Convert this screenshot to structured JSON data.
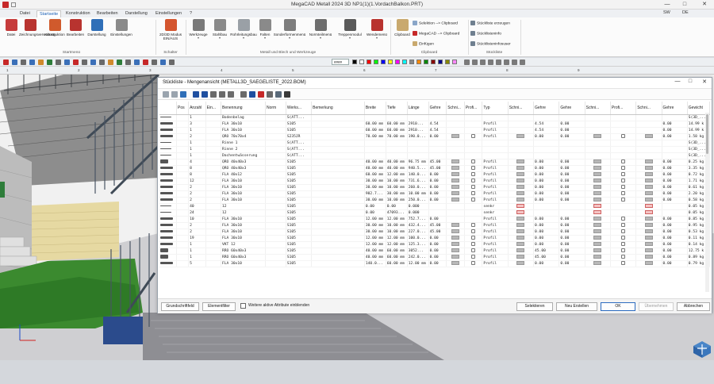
{
  "app": {
    "title": "MegaCAD Metall 2024 3D NP1(1)(1.VordachBalkon.PRT)",
    "user": "SW",
    "help": "?",
    "lang": "DE"
  },
  "ribbon_tabs": [
    "Datei",
    "Startseite",
    "Konstruktion",
    "Bearbeiten",
    "Darstellung",
    "Einstellungen",
    "?"
  ],
  "ribbon": {
    "start_buttons": [
      {
        "label": "Datei",
        "color": "#c63b3b"
      },
      {
        "label": "Zeichnungsverwaltung",
        "color": "#b8332f"
      },
      {
        "label": "Konstruktion",
        "color": "#d05a2c"
      },
      {
        "label": "Bearbeiten",
        "color": "#b8332f"
      },
      {
        "label": "Darstellung",
        "color": "#2f6fb8"
      },
      {
        "label": "Einstellungen",
        "color": "#8a8a8a"
      }
    ],
    "start_group": "Startmenü",
    "switch_button": {
      "label_1": "2D/3D Modus",
      "label_2": "EIN/AUS"
    },
    "switch_group": "Schalter",
    "metal_buttons": [
      {
        "label": "Werkzeuge",
        "color": "#7a7a7a"
      },
      {
        "label": "Stahlbau",
        "color": "#8a8a8a"
      },
      {
        "label": "Rohrleitungsbau",
        "color": "#9aa0a6"
      },
      {
        "label": "Falten",
        "color": "#8a8a8a"
      },
      {
        "label": "Sonderformenmenü",
        "color": "#7d7d7d"
      },
      {
        "label": "Normteilmenü",
        "color": "#6e6e6e"
      },
      {
        "label": "Treppenmodul",
        "color": "#5a5a5a"
      },
      {
        "label": "Wendemenü",
        "color": "#b8332f"
      }
    ],
    "metal_group": "Metall und Blech und Werkzeuge",
    "clipboard_button": "Clipboard",
    "clipboard_items": [
      "Selektion --> Clipboard",
      "MegaCAD --> Clipboard",
      "Einfügen"
    ],
    "clipboard_group": "Clipboard",
    "parts_items": [
      "Stückliste erzeugen",
      "Stücklisteninfo",
      "Stücklisteninfosuser"
    ],
    "parts_group": "Stückliste"
  },
  "toolbar": {
    "pattern": "####",
    "ruler_numbers": [
      "1",
      "2",
      "3",
      "4",
      "5",
      "6",
      "7",
      "8",
      "9"
    ],
    "colors": [
      "#000000",
      "#ffffff",
      "#ff0000",
      "#00ff00",
      "#0000ff",
      "#ffff00",
      "#ff00ff",
      "#00ffff",
      "#888888",
      "#ff8800",
      "#008800",
      "#880000",
      "#000088",
      "#888800",
      "#ff88ff"
    ]
  },
  "dialog": {
    "title": "Stückliste - Mengenansicht (METALL3D_SAEGELISTE_2022.BOM)",
    "columns": [
      "",
      "Pos",
      "Anzahl",
      "Ein...",
      "Benennung",
      "Norm",
      "Werks...",
      "Bemerkung",
      "Breite",
      "Tiefe",
      "Länge",
      "Gehre",
      "Schni...",
      "Profi...",
      "Typ",
      "Schni...",
      "Gehre",
      "Gehre",
      "Schni...",
      "Profi...",
      "Schni...",
      "Gehre",
      "Gewicht"
    ],
    "rows": [
      {
        "thumb": "line",
        "pos": "",
        "anz": "1",
        "ein": "",
        "ben": "Bodenbelag",
        "benBlue": true,
        "norm": "",
        "werk": "S(ATT...",
        "werkBlue": false,
        "bem": "",
        "breite": "",
        "tiefe": "",
        "laenge": "",
        "gehre": "",
        "s1": "",
        "p1": "",
        "typ": "",
        "s2": "",
        "g2": "",
        "g3": "",
        "s3": "",
        "p2": "",
        "s4": "",
        "g4": "",
        "gew": "S(3D_..."
      },
      {
        "thumb": "bar",
        "pos": "",
        "anz": "3",
        "ein": "",
        "ben": "FLA 30x10",
        "benBlue": false,
        "norm": "",
        "werk": "S105",
        "werkBlue": true,
        "bem": "",
        "breite": "60.00 mm",
        "tiefe": "60.00 mm",
        "laenge": "2910...",
        "gehre": "4.54",
        "s1": "",
        "p1": "",
        "typ": "Profil",
        "s2": "",
        "g2": "4.54",
        "g3": "0.00",
        "s3": "",
        "p2": "",
        "s4": "",
        "g4": "0.00",
        "gew": "14.99 k"
      },
      {
        "thumb": "bar",
        "pos": "",
        "anz": "1",
        "ein": "",
        "ben": "FLA 30x10",
        "benBlue": false,
        "norm": "",
        "werk": "S105",
        "werkBlue": true,
        "bem": "",
        "breite": "60.00 mm",
        "tiefe": "60.00 mm",
        "laenge": "2910...",
        "gehre": "4.54",
        "s1": "",
        "p1": "",
        "typ": "Profil",
        "s2": "",
        "g2": "4.54",
        "g3": "0.00",
        "s3": "",
        "p2": "",
        "s4": "",
        "g4": "0.00",
        "gew": "14.99 k"
      },
      {
        "thumb": "bar",
        "pos": "",
        "anz": "2",
        "ein": "",
        "ben": "QRO 70x70x4",
        "benBlue": false,
        "norm": "",
        "werk": "S235JR",
        "werkBlue": true,
        "bem": "",
        "breite": "70.00 mm",
        "tiefe": "70.00 mm",
        "laenge": "190.0...",
        "gehre": "0.00",
        "s1": "m",
        "p1": "p",
        "typ": "Profil",
        "s2": "m",
        "g2": "0.00",
        "g3": "0.00",
        "s3": "m",
        "p2": "p",
        "s4": "m",
        "g4": "0.00",
        "gew": "1.58 kg"
      },
      {
        "thumb": "line",
        "pos": "",
        "anz": "1",
        "ein": "",
        "ben": "Rinne 1",
        "benBlue": true,
        "norm": "",
        "werk": "S(ATT...",
        "werkBlue": false,
        "bem": "",
        "breite": "",
        "tiefe": "",
        "laenge": "",
        "gehre": "",
        "s1": "",
        "p1": "",
        "typ": "",
        "s2": "",
        "g2": "",
        "g3": "",
        "s3": "",
        "p2": "",
        "s4": "",
        "g4": "",
        "gew": "S(3D_..."
      },
      {
        "thumb": "line",
        "pos": "",
        "anz": "1",
        "ein": "",
        "ben": "Rinne 2",
        "benBlue": true,
        "norm": "",
        "werk": "S(ATT...",
        "werkBlue": false,
        "bem": "",
        "breite": "",
        "tiefe": "",
        "laenge": "",
        "gehre": "",
        "s1": "",
        "p1": "",
        "typ": "",
        "s2": "",
        "g2": "",
        "g3": "",
        "s3": "",
        "p2": "",
        "s4": "",
        "g4": "",
        "gew": "S(3D_..."
      },
      {
        "thumb": "line",
        "pos": "",
        "anz": "1",
        "ein": "",
        "ben": "Dachentwässerung",
        "benBlue": true,
        "norm": "",
        "werk": "S(ATT...",
        "werkBlue": false,
        "bem": "",
        "breite": "",
        "tiefe": "",
        "laenge": "",
        "gehre": "",
        "s1": "",
        "p1": "",
        "typ": "",
        "s2": "",
        "g2": "",
        "g3": "",
        "s3": "",
        "p2": "",
        "s4": "",
        "g4": "",
        "gew": "S(3D_..."
      },
      {
        "thumb": "box",
        "pos": "",
        "anz": "4",
        "ein": "",
        "ben": "QRO 40x40x3",
        "benBlue": false,
        "norm": "",
        "werk": "S105",
        "werkBlue": true,
        "bem": "",
        "breite": "40.00 mm",
        "tiefe": "40.00 mm",
        "laenge": "96.75 mm",
        "gehre": "45.00",
        "s1": "m",
        "p1": "p",
        "typ": "Profil",
        "s2": "m",
        "g2": "0.00",
        "g3": "0.00",
        "s3": "m",
        "p2": "p",
        "s4": "m",
        "g4": "0.00",
        "gew": "0.25 kg"
      },
      {
        "thumb": "bar",
        "pos": "",
        "anz": "8",
        "ein": "",
        "ben": "QRO 40x40x3",
        "benBlue": false,
        "norm": "",
        "werk": "S105",
        "werkBlue": true,
        "bem": "",
        "breite": "40.00 mm",
        "tiefe": "40.00 mm",
        "laenge": "940.5...",
        "gehre": "45.00",
        "s1": "m",
        "p1": "p",
        "typ": "Profil",
        "s2": "m",
        "g2": "0.00",
        "g3": "0.00",
        "s3": "m",
        "p2": "p",
        "s4": "m",
        "g4": "0.00",
        "gew": "3.35 kg"
      },
      {
        "thumb": "bar",
        "pos": "",
        "anz": "8",
        "ein": "",
        "ben": "FLA 40x12",
        "benBlue": false,
        "norm": "",
        "werk": "S105",
        "werkBlue": true,
        "bem": "",
        "breite": "60.00 mm",
        "tiefe": "12.00 mm",
        "laenge": "140.0...",
        "gehre": "0.00",
        "s1": "m",
        "p1": "p",
        "typ": "Profil",
        "s2": "m",
        "g2": "0.00",
        "g3": "0.00",
        "s3": "m",
        "p2": "p",
        "s4": "m",
        "g4": "0.00",
        "gew": "0.72 kg"
      },
      {
        "thumb": "bar",
        "pos": "",
        "anz": "12",
        "ein": "",
        "ben": "FLA 30x10",
        "benBlue": false,
        "norm": "",
        "werk": "S105",
        "werkBlue": true,
        "bem": "",
        "breite": "30.00 mm",
        "tiefe": "10.00 mm",
        "laenge": "731.6...",
        "gehre": "0.00",
        "s1": "m",
        "p1": "p",
        "typ": "Profil",
        "s2": "m",
        "g2": "0.00",
        "g3": "0.00",
        "s3": "m",
        "p2": "p",
        "s4": "m",
        "g4": "0.00",
        "gew": "1.71 kg"
      },
      {
        "thumb": "bar",
        "pos": "",
        "anz": "2",
        "ein": "",
        "ben": "FLA 30x10",
        "benBlue": false,
        "norm": "",
        "werk": "S105",
        "werkBlue": true,
        "bem": "",
        "breite": "30.00 mm",
        "tiefe": "10.00 mm",
        "laenge": "260.0...",
        "gehre": "0.00",
        "s1": "m",
        "p1": "p",
        "typ": "Profil",
        "s2": "m",
        "g2": "0.00",
        "g3": "0.00",
        "s3": "m",
        "p2": "p",
        "s4": "m",
        "g4": "0.00",
        "gew": "0.61 kg"
      },
      {
        "thumb": "bar",
        "pos": "",
        "anz": "2",
        "ein": "",
        "ben": "FLA 30x10",
        "benBlue": false,
        "norm": "",
        "werk": "S105",
        "werkBlue": true,
        "bem": "",
        "breite": "902.7...",
        "tiefe": "30.00 mm",
        "laenge": "10.00 mm",
        "gehre": "0.00",
        "s1": "m",
        "p1": "p",
        "typ": "Profil",
        "s2": "m",
        "g2": "0.00",
        "g3": "0.00",
        "s3": "m",
        "p2": "p",
        "s4": "m",
        "g4": "0.00",
        "gew": "2.20 kg"
      },
      {
        "thumb": "bar",
        "pos": "",
        "anz": "2",
        "ein": "",
        "ben": "FLA 30x10",
        "benBlue": false,
        "norm": "",
        "werk": "S105",
        "werkBlue": true,
        "bem": "",
        "breite": "30.00 mm",
        "tiefe": "10.00 mm",
        "laenge": "250.0...",
        "gehre": "0.00",
        "s1": "m",
        "p1": "p",
        "typ": "Profil",
        "s2": "m",
        "g2": "0.00",
        "g3": "0.00",
        "s3": "m",
        "p2": "p",
        "s4": "m",
        "g4": "0.00",
        "gew": "0.58 kg"
      },
      {
        "thumb": "line",
        "pos": "",
        "anz": "40",
        "ein": "",
        "ben": "12",
        "benBlue": false,
        "norm": "",
        "werk": "S105",
        "werkBlue": true,
        "bem": "",
        "breite": "0.00",
        "tiefe": "0.00",
        "laenge": "0.000",
        "gehre": "",
        "s1": "",
        "p1": "",
        "typ": "senkr",
        "s2": "r",
        "g2": "",
        "g3": "",
        "s3": "r",
        "p2": "",
        "s4": "r",
        "g4": "",
        "gew": "0.05 kg"
      },
      {
        "thumb": "line",
        "pos": "",
        "anz": "24",
        "ein": "",
        "ben": "12",
        "benBlue": false,
        "norm": "",
        "werk": "S105",
        "werkBlue": true,
        "bem": "",
        "breite": "0.00",
        "tiefe": "47093...",
        "laenge": "0.000",
        "gehre": "",
        "s1": "",
        "p1": "",
        "typ": "senkr",
        "s2": "r",
        "g2": "",
        "g3": "",
        "s3": "r",
        "p2": "",
        "s4": "r",
        "g4": "",
        "gew": "0.05 kg"
      },
      {
        "thumb": "bar",
        "pos": "",
        "anz": "10",
        "ein": "",
        "ben": "FLA 30x10",
        "benBlue": false,
        "norm": "",
        "werk": "S105",
        "werkBlue": true,
        "bem": "",
        "breite": "12.00 mm",
        "tiefe": "12.00 mm",
        "laenge": "752.7...",
        "gehre": "0.00",
        "s1": "",
        "p1": "",
        "typ": "Profil",
        "s2": "m",
        "g2": "0.00",
        "g3": "0.00",
        "s3": "m",
        "p2": "p",
        "s4": "m",
        "g4": "0.00",
        "gew": "0.85 kg"
      },
      {
        "thumb": "bar",
        "pos": "",
        "anz": "2",
        "ein": "",
        "ben": "FLA 30x10",
        "benBlue": false,
        "norm": "",
        "werk": "S105",
        "werkBlue": true,
        "bem": "",
        "breite": "30.00 mm",
        "tiefe": "10.00 mm",
        "laenge": "432.4...",
        "gehre": "45.00",
        "s1": "m",
        "p1": "p",
        "typ": "Profil",
        "s2": "m",
        "g2": "0.00",
        "g3": "0.00",
        "s3": "m",
        "p2": "p",
        "s4": "m",
        "g4": "0.00",
        "gew": "0.95 kg"
      },
      {
        "thumb": "bar",
        "pos": "",
        "anz": "2",
        "ein": "",
        "ben": "FLA 30x10",
        "benBlue": false,
        "norm": "",
        "werk": "S105",
        "werkBlue": true,
        "bem": "",
        "breite": "30.00 mm",
        "tiefe": "10.00 mm",
        "laenge": "227.0...",
        "gehre": "45.00",
        "s1": "m",
        "p1": "p",
        "typ": "Profil",
        "s2": "m",
        "g2": "0.00",
        "g3": "0.00",
        "s3": "m",
        "p2": "p",
        "s4": "m",
        "g4": "0.00",
        "gew": "0.53 kg"
      },
      {
        "thumb": "bar",
        "pos": "",
        "anz": "19",
        "ein": "",
        "ben": "FLA 30x10",
        "benBlue": false,
        "norm": "",
        "werk": "S105",
        "werkBlue": true,
        "bem": "",
        "breite": "12.00 mm",
        "tiefe": "12.00 mm",
        "laenge": "100.0...",
        "gehre": "0.00",
        "s1": "m",
        "p1": "p",
        "typ": "Profil",
        "s2": "m",
        "g2": "0.00",
        "g3": "0.00",
        "s3": "m",
        "p2": "p",
        "s4": "m",
        "g4": "0.00",
        "gew": "0.11 kg"
      },
      {
        "thumb": "bar",
        "pos": "",
        "anz": "1",
        "ein": "",
        "ben": "VKT 12",
        "benBlue": false,
        "norm": "",
        "werk": "S105",
        "werkBlue": true,
        "bem": "",
        "breite": "12.00 mm",
        "tiefe": "12.00 mm",
        "laenge": "125.3...",
        "gehre": "0.00",
        "s1": "m",
        "p1": "p",
        "typ": "Profil",
        "s2": "m",
        "g2": "0.00",
        "g3": "0.00",
        "s3": "m",
        "p2": "p",
        "s4": "m",
        "g4": "0.00",
        "gew": "0.14 kg"
      },
      {
        "thumb": "box",
        "pos": "",
        "anz": "1",
        "ein": "",
        "ben": "RRO 60x40x3",
        "benBlue": false,
        "norm": "",
        "werk": "S105",
        "werkBlue": true,
        "bem": "",
        "breite": "40.00 mm",
        "tiefe": "60.00 mm",
        "laenge": "3052...",
        "gehre": "0.00",
        "s1": "m",
        "p1": "p",
        "typ": "Profil",
        "s2": "m",
        "g2": "45.00",
        "g3": "0.00",
        "s3": "m",
        "p2": "p",
        "s4": "m",
        "g4": "0.00",
        "gew": "12.75 k"
      },
      {
        "thumb": "box",
        "pos": "",
        "anz": "1",
        "ein": "",
        "ben": "RRO 60x40x3",
        "benBlue": false,
        "norm": "",
        "werk": "S105",
        "werkBlue": true,
        "bem": "",
        "breite": "40.00 mm",
        "tiefe": "60.00 mm",
        "laenge": "242.0...",
        "gehre": "0.00",
        "s1": "m",
        "p1": "p",
        "typ": "Profil",
        "s2": "m",
        "g2": "45.00",
        "g3": "0.00",
        "s3": "m",
        "p2": "p",
        "s4": "m",
        "g4": "0.00",
        "gew": "0.89 kg"
      },
      {
        "thumb": "bar",
        "pos": "",
        "anz": "5",
        "ein": "",
        "ben": "FLA 30x10",
        "benBlue": false,
        "norm": "",
        "werk": "S105",
        "werkBlue": true,
        "bem": "",
        "breite": "140.0...",
        "tiefe": "60.00 mm",
        "laenge": "12.00 mm",
        "gehre": "0.00",
        "s1": "m",
        "p1": "p",
        "typ": "Profil",
        "s2": "m",
        "g2": "0.00",
        "g3": "0.00",
        "s3": "m",
        "p2": "p",
        "s4": "m",
        "g4": "0.00",
        "gew": "0.79 kg"
      }
    ],
    "footer": {
      "basic_fields": "Grundschriftfeld",
      "element_filter": "Elementfilter",
      "show_more_label": "Weitere aktive Attribute einblenden",
      "select": "Selektieren",
      "new_create": "Neu Erstellen",
      "ok": "OK",
      "apply": "Übernehmen",
      "cancel": "Abbrechen"
    }
  }
}
